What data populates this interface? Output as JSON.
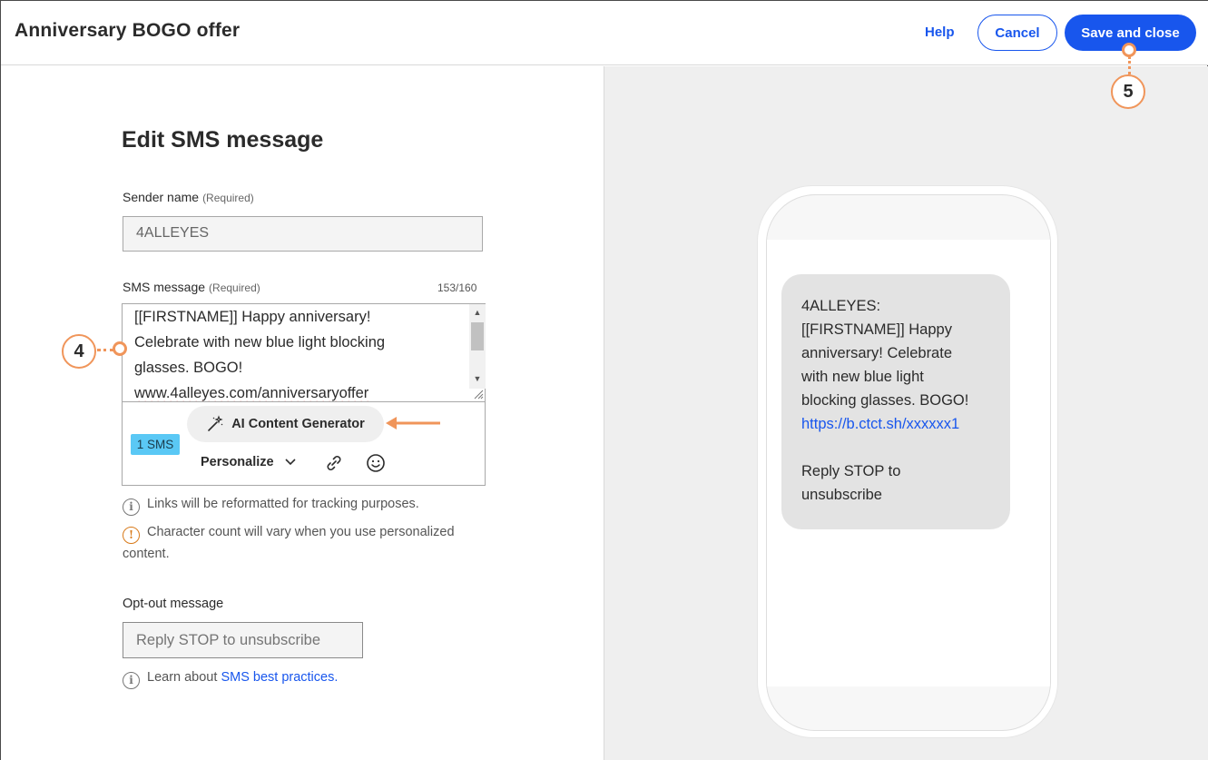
{
  "header": {
    "title": "Anniversary BOGO offer",
    "help_label": "Help",
    "cancel_label": "Cancel",
    "save_label": "Save and close"
  },
  "editor": {
    "heading": "Edit SMS message",
    "sender": {
      "label": "Sender name",
      "required": "(Required)",
      "value": "4ALLEYES"
    },
    "sms": {
      "label": "SMS message",
      "required": "(Required)",
      "count": "153/160",
      "lines": [
        "[[FIRSTNAME]] Happy anniversary!",
        "Celebrate with new blue light blocking",
        "glasses. BOGO!",
        "www.4alleyes.com/anniversaryoffer"
      ],
      "ai_button": "AI Content Generator",
      "badge": "1 SMS",
      "personalize": "Personalize"
    },
    "notes": {
      "links": "Links will be reformatted for tracking purposes.",
      "charcount_line1": "Character count will vary when you use personalized",
      "charcount_line2": "content."
    },
    "optout": {
      "label": "Opt-out message",
      "placeholder": "Reply STOP to unsubscribe"
    },
    "learn": {
      "prefix": "Learn about ",
      "link": "SMS best practices."
    }
  },
  "callouts": {
    "step4": "4",
    "step5": "5"
  },
  "preview": {
    "lines": [
      "4ALLEYES:",
      "[[FIRSTNAME]] Happy",
      "anniversary! Celebrate",
      "with new blue light",
      "blocking glasses. BOGO!"
    ],
    "link": "https://b.ctct.sh/xxxxxx1",
    "optout_line1": "Reply STOP to",
    "optout_line2": "unsubscribe"
  },
  "colors": {
    "accent": "#1856ed",
    "callout": "#f0955a",
    "badge": "#5ac8f5"
  }
}
